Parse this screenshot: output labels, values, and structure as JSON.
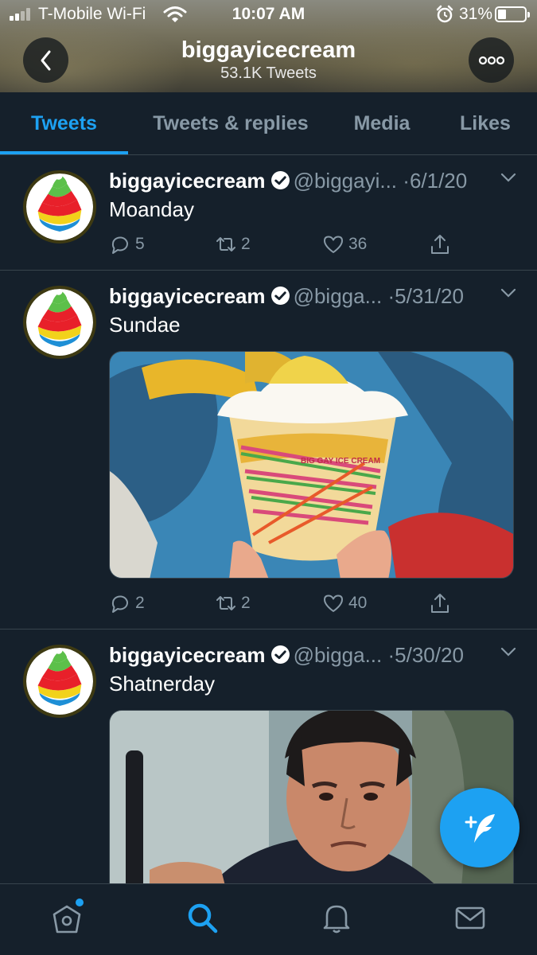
{
  "status_bar": {
    "carrier": "T-Mobile Wi-Fi",
    "time": "10:07 AM",
    "battery": "31%",
    "battery_level": 0.31
  },
  "profile": {
    "name": "biggayicecream",
    "tweet_count": "53.1K Tweets"
  },
  "tabs": [
    {
      "label": "Tweets",
      "active": true
    },
    {
      "label": "Tweets & replies",
      "active": false
    },
    {
      "label": "Media",
      "active": false
    },
    {
      "label": "Likes",
      "active": false
    }
  ],
  "tweets": [
    {
      "name": "biggayicecream",
      "handle": "@biggayi...",
      "date": "6/1/20",
      "text": "Moanday",
      "replies": "5",
      "retweets": "2",
      "likes": "36"
    },
    {
      "name": "biggayicecream",
      "handle": "@bigga...",
      "date": "5/31/20",
      "text": "Sundae",
      "replies": "2",
      "retweets": "2",
      "likes": "40",
      "media_cup_text": "BIG GAY ICE CREAM"
    },
    {
      "name": "biggayicecream",
      "handle": "@bigga...",
      "date": "5/30/20",
      "text": "Shatnerday"
    }
  ],
  "separator": "·",
  "colors": {
    "background": "#15202b",
    "accent": "#1da1f2",
    "muted": "#8899a6",
    "divider": "#38444d"
  },
  "icons": {
    "back": "chevron-left-icon",
    "more": "ellipsis-icon",
    "reply": "comment-icon",
    "retweet": "retweet-icon",
    "like": "heart-icon",
    "share": "share-icon",
    "compose": "feather-plus-icon",
    "nav": [
      "home-icon",
      "search-icon",
      "bell-icon",
      "mail-icon"
    ]
  }
}
